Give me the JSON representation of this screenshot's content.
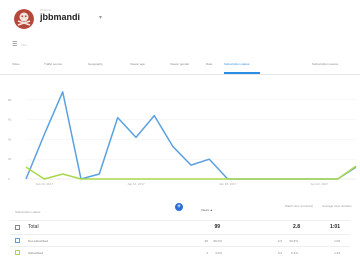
{
  "channel": {
    "eyebrow": "Channel",
    "name": "jbbmandi"
  },
  "filter": {
    "label": "Filter"
  },
  "tabs": [
    "Video",
    "Traffic source",
    "Geography",
    "Viewer age",
    "Viewer gender",
    "Date",
    "Subscription status",
    "Subscription source"
  ],
  "active_tab": "Subscription status",
  "chart_data": {
    "type": "line",
    "x": [
      1,
      2,
      3,
      4,
      5,
      6,
      7,
      8,
      9,
      10,
      11,
      12,
      13,
      14,
      15,
      16,
      17,
      18,
      19
    ],
    "xticks": [
      "Jan 10, 2017",
      "Jan 14, 2017",
      "Jan 18, 2017",
      "Jan 22, 2017"
    ],
    "yticks": [
      "80",
      "60",
      "40",
      "20",
      "0"
    ],
    "ylim": [
      0,
      100
    ],
    "series": [
      {
        "color": "#5aa0e0",
        "values": [
          0,
          45,
          88,
          0,
          5,
          62,
          42,
          64,
          33,
          14,
          20,
          0,
          0,
          0,
          0,
          0,
          0,
          0,
          12
        ]
      },
      {
        "color": "#a8d84a",
        "values": [
          12,
          0,
          5,
          0,
          0,
          0,
          0,
          0,
          0,
          0,
          0,
          0,
          0,
          0,
          0,
          0,
          0,
          0,
          13
        ]
      }
    ]
  },
  "table": {
    "col_status": "Subscription status",
    "col_views": "Views",
    "sort_arrow": "▲",
    "col_watch": "Watch time (minutes)",
    "col_avg": "Average view duration",
    "badge": "+",
    "rows": [
      {
        "label": "Total",
        "views": "99",
        "views_pct": "",
        "watch": "2.8",
        "watch_pct": "",
        "avg": "1:01",
        "swatch": ""
      },
      {
        "label": "Not subscribed",
        "views": "95",
        "views_pct": "96.0%",
        "watch": "2.6",
        "watch_pct": "93.6%",
        "avg": "1:00",
        "swatch": "#5aa0e0"
      },
      {
        "label": "Subscribed",
        "views": "4",
        "views_pct": "4.0%",
        "watch": "0.2",
        "watch_pct": "6.4%",
        "avg": "1:33",
        "swatch": "#a8d84a"
      }
    ]
  }
}
